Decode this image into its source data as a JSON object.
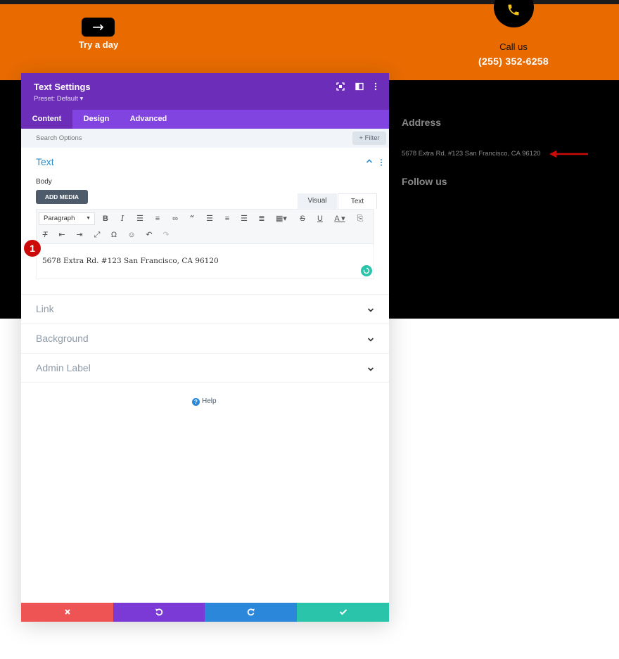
{
  "site": {
    "arrow_glyph": "→",
    "try_label": "Try a day",
    "call_label": "Call us",
    "call_number": "(255) 352-6258",
    "address_heading": "Address",
    "address_text": "5678 Extra Rd. #123 San Francisco, CA 96120",
    "follow_heading": "Follow us",
    "colors": {
      "orange": "#e96b00",
      "dark": "#000000",
      "phone_icon": "#f2c318",
      "annotation_red": "#cc0a0a"
    }
  },
  "modal": {
    "title": "Text Settings",
    "preset": "Preset: Default ▾",
    "header_icons": [
      "fullscreen-icon",
      "split-view-icon",
      "more-options-icon"
    ],
    "tabs": [
      {
        "label": "Content",
        "active": true
      },
      {
        "label": "Design",
        "active": false
      },
      {
        "label": "Advanced",
        "active": false
      }
    ],
    "search": {
      "placeholder": "Search Options",
      "value": ""
    },
    "filter_label": "+ Filter",
    "text_section": {
      "title": "Text",
      "body_label": "Body",
      "add_media_label": "ADD MEDIA",
      "editor_tabs": [
        "Visual",
        "Text"
      ],
      "paragraph_select": "Paragraph",
      "content": "5678 Extra Rd. #123 San Francisco, CA 96120"
    },
    "annotation_number": "1",
    "sections": [
      {
        "label": "Link"
      },
      {
        "label": "Background"
      },
      {
        "label": "Admin Label"
      }
    ],
    "help_label": "Help",
    "footer": {
      "cancel_color": "#ef5455",
      "undo_color": "#7b3ad5",
      "redo_color": "#2b87da",
      "save_color": "#29c4a9"
    },
    "colors": {
      "header": "#6c2eb9",
      "tabs": "#8144e1",
      "accent": "#2e8ec8"
    }
  }
}
